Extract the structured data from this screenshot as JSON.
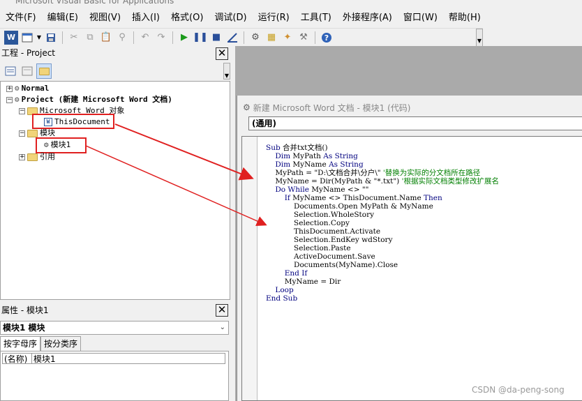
{
  "window": {
    "title": "Microsoft Visual Basic for Applications"
  },
  "menu": [
    "文件(F)",
    "编辑(E)",
    "视图(V)",
    "插入(I)",
    "格式(O)",
    "调试(D)",
    "运行(R)",
    "工具(T)",
    "外接程序(A)",
    "窗口(W)",
    "帮助(H)"
  ],
  "toolbar": {
    "icons": [
      "word-icon",
      "insert-form-icon",
      "save-icon",
      "cut-icon",
      "copy-icon",
      "paste-icon",
      "find-icon",
      "undo-icon",
      "redo-icon",
      "run-icon",
      "break-icon",
      "reset-icon",
      "design-mode-icon",
      "project-explorer-icon",
      "properties-icon",
      "object-browser-icon",
      "toolbox-icon",
      "help-icon"
    ]
  },
  "project": {
    "title": "工程 - Project",
    "tree": {
      "normal": "Normal",
      "project": "Project (新建 Microsoft Word 文档)",
      "word_objects": "Microsoft Word 对象",
      "this_document": "ThisDocument",
      "modules": "模块",
      "module1": "模块1",
      "references": "引用"
    }
  },
  "properties": {
    "title": "属性 - 模块1",
    "selector": "模块1 模块",
    "tabs": [
      "按字母序",
      "按分类序"
    ],
    "rows": [
      {
        "name": "(名称)",
        "value": "模块1"
      }
    ]
  },
  "code_window": {
    "title": "新建 Microsoft Word 文档 - 模块1 (代码)",
    "object_combo": "(通用)",
    "lines": [
      [
        [
          "kw",
          "Sub"
        ],
        [
          "t",
          " 合并txt文档()"
        ]
      ],
      [
        [
          "t",
          "    "
        ],
        [
          "kw",
          "Dim"
        ],
        [
          "t",
          " MyPath "
        ],
        [
          "kw",
          "As String"
        ]
      ],
      [
        [
          "t",
          "    "
        ],
        [
          "kw",
          "Dim"
        ],
        [
          "t",
          " MyName "
        ],
        [
          "kw",
          "As String"
        ]
      ],
      [
        [
          "t",
          "    MyPath = \"D:\\文档合并\\分户\\\" "
        ],
        [
          "cm",
          "'替换为实际的分文档所在路径"
        ]
      ],
      [
        [
          "t",
          "    MyName = Dir(MyPath & \"*.txt\") "
        ],
        [
          "cm",
          "'根据实际文档类型修改扩展名"
        ]
      ],
      [
        [
          "t",
          "    "
        ],
        [
          "kw",
          "Do While"
        ],
        [
          "t",
          " MyName <> \"\""
        ]
      ],
      [
        [
          "t",
          "        "
        ],
        [
          "kw",
          "If"
        ],
        [
          "t",
          " MyName <> ThisDocument.Name "
        ],
        [
          "kw",
          "Then"
        ]
      ],
      [
        [
          "t",
          "            Documents.Open MyPath & MyName"
        ]
      ],
      [
        [
          "t",
          "            Selection.WholeStory"
        ]
      ],
      [
        [
          "t",
          "            Selection.Copy"
        ]
      ],
      [
        [
          "t",
          "            ThisDocument.Activate"
        ]
      ],
      [
        [
          "t",
          "            Selection.EndKey wdStory"
        ]
      ],
      [
        [
          "t",
          "            Selection.Paste"
        ]
      ],
      [
        [
          "t",
          "            ActiveDocument.Save"
        ]
      ],
      [
        [
          "t",
          "            Documents(MyName).Close"
        ]
      ],
      [
        [
          "t",
          "        "
        ],
        [
          "kw",
          "End If"
        ]
      ],
      [
        [
          "t",
          "        MyName = Dir"
        ]
      ],
      [
        [
          "t",
          "    "
        ],
        [
          "kw",
          "Loop"
        ]
      ],
      [
        [
          "kw",
          "End Sub"
        ]
      ]
    ]
  },
  "watermark": "CSDN @da-peng-song",
  "colors": {
    "annotation": "#e02020",
    "keyword": "#00007f",
    "comment": "#007f00"
  }
}
